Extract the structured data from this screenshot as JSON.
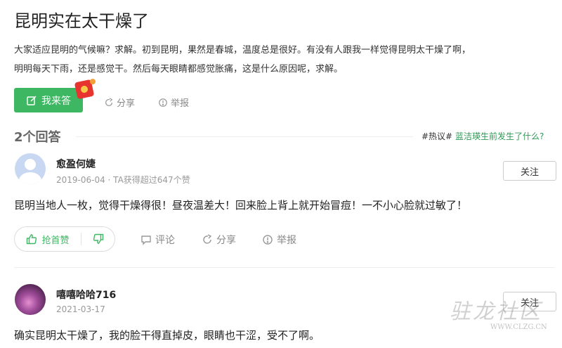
{
  "question": {
    "title": "昆明实在太干燥了",
    "desc_line1": "大家适应昆明的气候嘛？求解。初到昆明，果然是春城，温度总是很好。有没有人跟我一样觉得昆明太干燥了啊，",
    "desc_line2": "明明每天下雨，还是感觉干。然后每天眼睛都感觉胀痛，这是什么原因呢，求解。",
    "answer_label": "我来答",
    "share_label": "分享",
    "report_label": "举报"
  },
  "answers_header": {
    "count_label": "2个回答",
    "hot_tag": "#热议#",
    "hot_link": "蓝洁瑛生前发生了什么?"
  },
  "answers": [
    {
      "name": "愈盈何婕",
      "meta": "2019-06-04 · TA获得超过647个赞",
      "follow_label": "关注",
      "content": "昆明当地人一枚，觉得干燥得很！昼夜温差大！回来脸上背上就开始冒痘！一不小心脸就过敏了！",
      "vote_label": "抢首赞",
      "comment_label": "评论",
      "share_label": "分享",
      "report_label": "举报"
    },
    {
      "name": "嘻嘻哈哈716",
      "meta": "2021-03-17",
      "follow_label": "关注",
      "content": "确实昆明太干燥了，我的脸干得直掉皮，眼睛也干涩，受不了啊。"
    }
  ],
  "watermark": {
    "text": "驻龙社区",
    "url": "WWW.CLZG.CN"
  },
  "colors": {
    "accent": "#3eb763",
    "link": "#2f9a55"
  }
}
